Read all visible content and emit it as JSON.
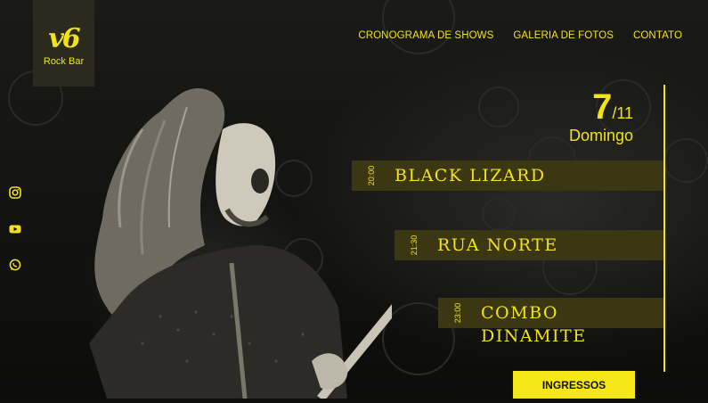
{
  "logo": {
    "mark": "v6",
    "text": "Rock Bar"
  },
  "nav": {
    "items": [
      "CRONOGRAMA DE SHOWS",
      "GALERIA DE FOTOS",
      "CONTATO"
    ]
  },
  "social": {
    "icons": [
      "instagram-icon",
      "youtube-icon",
      "whatsapp-icon"
    ]
  },
  "date": {
    "day": "7",
    "month": "/11",
    "weekday": "Domingo"
  },
  "shows": [
    {
      "time": "20:00",
      "name": "BLACK LIZARD"
    },
    {
      "time": "21:30",
      "name": "RUA NORTE"
    },
    {
      "time": "23:00",
      "name": "COMBO DINAMITE"
    }
  ],
  "cta": {
    "label": "INGRESSOS"
  },
  "colors": {
    "accent": "#f2e318",
    "background": "#0e0e0c",
    "bar": "#3b3713"
  }
}
